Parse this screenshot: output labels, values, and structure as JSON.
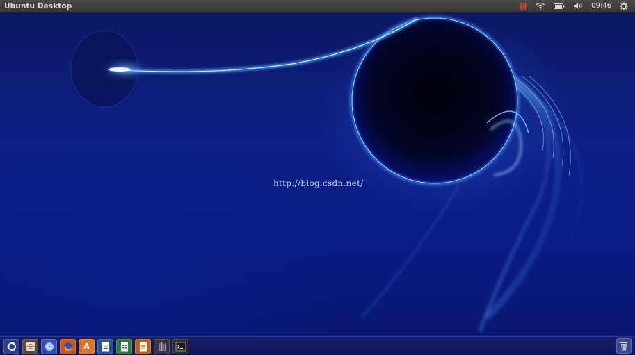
{
  "top_panel": {
    "title": "Ubuntu Desktop",
    "ime_indicator": "拼",
    "clock": "09:46",
    "icons": [
      "ime-icon",
      "wifi-icon",
      "battery-icon",
      "volume-icon",
      "gear-icon"
    ]
  },
  "desktop": {
    "watermark": "http://blog.csdn.net/"
  },
  "launcher": {
    "items": [
      {
        "name": "dash-home",
        "icon": "ubuntu-logo-icon",
        "color": "#2f3d8f"
      },
      {
        "name": "files",
        "icon": "file-cabinet-icon",
        "color": "#5a4a3a"
      },
      {
        "name": "web-browser",
        "icon": "globe-icon",
        "color": "#3b4bb0"
      },
      {
        "name": "firefox",
        "icon": "firefox-icon",
        "color": "#c4581f"
      },
      {
        "name": "software-center",
        "icon": "software-center-icon",
        "glyph": "A",
        "color": "#d9772e"
      },
      {
        "name": "libreoffice-writer",
        "icon": "writer-doc-icon",
        "color": "#2c4f9e"
      },
      {
        "name": "libreoffice-calc",
        "icon": "calc-sheet-icon",
        "color": "#2f7a3a"
      },
      {
        "name": "libreoffice-impress",
        "icon": "impress-slide-icon",
        "color": "#b8601e"
      },
      {
        "name": "books",
        "icon": "books-icon",
        "color": "#3a3340"
      },
      {
        "name": "terminal",
        "icon": "terminal-icon",
        "color": "#2b2b2b"
      }
    ],
    "trash_icon": "trash-icon"
  },
  "colors": {
    "panel_bg": "#3f3e3a",
    "panel_text": "#dfdbd2",
    "ime_red": "#e03a2b",
    "wallpaper_base": "#0e1f86",
    "glow_blue": "#4fb0ff"
  }
}
